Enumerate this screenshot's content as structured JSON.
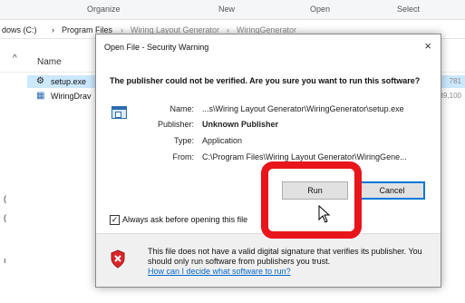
{
  "ribbon": {
    "groups": [
      "Organize",
      "New",
      "Open",
      "Select"
    ]
  },
  "address": {
    "root_fragment": "dows (C:)",
    "sep": "›",
    "crumb_1": "Program Files",
    "crumb_2": "Wiring Layout Generator",
    "crumb_3": "WiringGenerator"
  },
  "file_list": {
    "sort_arrow": "^",
    "column_name": "Name",
    "files": [
      {
        "name": "setup.exe",
        "size": "781"
      },
      {
        "name": "WiringDrav",
        "size": "39,100"
      }
    ]
  },
  "dialog": {
    "title": "Open File - Security Warning",
    "close_glyph": "×",
    "warning_heading": "The publisher could not be verified.  Are you sure you want to run this software?",
    "fields": {
      "name_label": "Name:",
      "name_value": "...s\\Wiring Layout Generator\\WiringGenerator\\setup.exe",
      "publisher_label": "Publisher:",
      "publisher_value": "Unknown Publisher",
      "type_label": "Type:",
      "type_value": "Application",
      "from_label": "From:",
      "from_value": "C:\\Program Files\\Wiring Layout Generator\\WiringGene..."
    },
    "run_label": "Run",
    "cancel_label": "Cancel",
    "checkbox_label": "Always ask before opening this file",
    "checkbox_checked": true,
    "checkbox_glyph": "✓",
    "footer_text": "This file does not have a valid digital signature that verifies its publisher.  You should only run software from publishers you trust.",
    "footer_link": "How can I decide what software to run?"
  },
  "colors": {
    "annotation_red": "#e8151b",
    "link_blue": "#0066cc",
    "selection_blue": "#cce8ff",
    "default_button_border": "#0078d7"
  }
}
